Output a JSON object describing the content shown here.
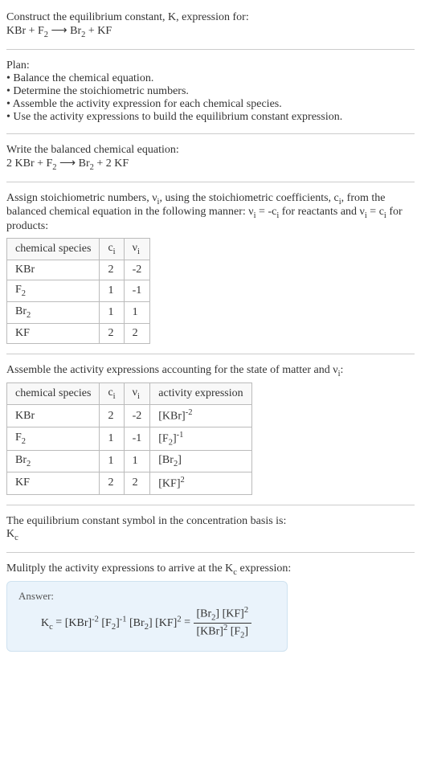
{
  "prompt": {
    "line1": "Construct the equilibrium constant, K, expression for:",
    "equation_lhs1": "KBr + F",
    "equation_sub1": "2",
    "equation_arrow": " ⟶ ",
    "equation_rhs1": "Br",
    "equation_sub2": "2",
    "equation_rhs2": " + KF"
  },
  "plan": {
    "heading": "Plan:",
    "b1": "• Balance the chemical equation.",
    "b2": "• Determine the stoichiometric numbers.",
    "b3": "• Assemble the activity expression for each chemical species.",
    "b4": "• Use the activity expressions to build the equilibrium constant expression."
  },
  "balanced": {
    "heading": "Write the balanced chemical equation:",
    "eq_a": "2 KBr + F",
    "eq_sub1": "2",
    "eq_arrow": " ⟶ ",
    "eq_b": "Br",
    "eq_sub2": "2",
    "eq_c": " + 2 KF"
  },
  "assign": {
    "text_a": "Assign stoichiometric numbers, ν",
    "text_a_sub": "i",
    "text_b": ", using the stoichiometric coefficients, c",
    "text_b_sub": "i",
    "text_c": ", from the balanced chemical equation in the following manner: ν",
    "text_c_sub": "i",
    "text_d": " = -c",
    "text_d_sub": "i",
    "text_e": " for reactants and ν",
    "text_e_sub": "i",
    "text_f": " = c",
    "text_f_sub": "i",
    "text_g": " for products:"
  },
  "table1": {
    "h1": "chemical species",
    "h2_a": "c",
    "h2_sub": "i",
    "h3_a": "ν",
    "h3_sub": "i",
    "r1c1": "KBr",
    "r1c2": "2",
    "r1c3": "-2",
    "r2c1_a": "F",
    "r2c1_sub": "2",
    "r2c2": "1",
    "r2c3": "-1",
    "r3c1_a": "Br",
    "r3c1_sub": "2",
    "r3c2": "1",
    "r3c3": "1",
    "r4c1": "KF",
    "r4c2": "2",
    "r4c3": "2"
  },
  "assemble": {
    "text_a": "Assemble the activity expressions accounting for the state of matter and ν",
    "text_sub": "i",
    "text_b": ":"
  },
  "table2": {
    "h1": "chemical species",
    "h2_a": "c",
    "h2_sub": "i",
    "h3_a": "ν",
    "h3_sub": "i",
    "h4": "activity expression",
    "r1c1": "KBr",
    "r1c2": "2",
    "r1c3": "-2",
    "r1c4_a": "[KBr]",
    "r1c4_sup": "-2",
    "r2c1_a": "F",
    "r2c1_sub": "2",
    "r2c2": "1",
    "r2c3": "-1",
    "r2c4_a": "[F",
    "r2c4_sub": "2",
    "r2c4_b": "]",
    "r2c4_sup": "-1",
    "r3c1_a": "Br",
    "r3c1_sub": "2",
    "r3c2": "1",
    "r3c3": "1",
    "r3c4_a": "[Br",
    "r3c4_sub": "2",
    "r3c4_b": "]",
    "r4c1": "KF",
    "r4c2": "2",
    "r4c3": "2",
    "r4c4_a": "[KF]",
    "r4c4_sup": "2"
  },
  "symbol": {
    "line1": "The equilibrium constant symbol in the concentration basis is:",
    "kc_a": "K",
    "kc_sub": "c"
  },
  "multiply": {
    "text_a": "Mulitply the activity expressions to arrive at the K",
    "text_sub": "c",
    "text_b": " expression:"
  },
  "answer": {
    "label": "Answer:",
    "lhs_a": "K",
    "lhs_sub": "c",
    "eq": " = ",
    "t1_a": "[KBr]",
    "t1_sup": "-2",
    "t2_a": " [F",
    "t2_sub": "2",
    "t2_b": "]",
    "t2_sup": "-1",
    "t3_a": " [Br",
    "t3_sub": "2",
    "t3_b": "]",
    "t4_a": " [KF]",
    "t4_sup": "2",
    "eq2": " = ",
    "num_a": "[Br",
    "num_sub": "2",
    "num_b": "] [KF]",
    "num_sup": "2",
    "den_a": "[KBr]",
    "den_sup": "2",
    "den_b": " [F",
    "den_sub": "2",
    "den_c": "]"
  }
}
